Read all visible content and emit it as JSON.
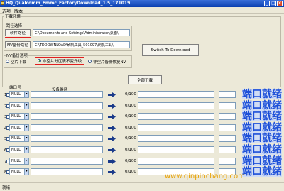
{
  "window": {
    "title": "HQ_Qualcomm_Emmc_FactoryDownload_1.5_171019"
  },
  "menu": {
    "items": [
      "选项",
      "版本"
    ]
  },
  "download_env": {
    "group_label": "下载环境",
    "path_group_label": "路径选择",
    "software_path_button": "软件路径",
    "software_path_value": "C:\\Documents and Settings\\Administrator\\桌面\\",
    "nv_backup_button": "NV备份路径",
    "nv_backup_value": "C:\\TDDOWNLOAD\\刷机工具_501097\\刷机工具\\"
  },
  "switch_button": "Switch To Download",
  "nv_options": {
    "group_label": "NV备份选项",
    "options": [
      "空片下载",
      "非空片分区表不变升级",
      "非空片备份恢复NV"
    ],
    "selected": 1
  },
  "download_all_button": "全部下载",
  "ports": {
    "port_header": "端口号",
    "device_path_header": "设备路径",
    "rows": [
      {
        "num": "1",
        "port": "NULL",
        "progress": "0/100",
        "status": "端口就绪"
      },
      {
        "num": "2",
        "port": "NULL",
        "progress": "0/100",
        "status": "端口就绪"
      },
      {
        "num": "3",
        "port": "NULL",
        "progress": "0/100",
        "status": "端口就绪"
      },
      {
        "num": "4",
        "port": "NULL",
        "progress": "0/100",
        "status": "端口就绪"
      },
      {
        "num": "5",
        "port": "NULL",
        "progress": "0/100",
        "status": "端口就绪"
      },
      {
        "num": "6",
        "port": "NULL",
        "progress": "0/100",
        "status": "端口就绪"
      },
      {
        "num": "7",
        "port": "NULL",
        "progress": "0/100",
        "status": "端口就绪"
      },
      {
        "num": "8",
        "port": "NULL",
        "progress": "0/100",
        "status": "端口就绪"
      }
    ]
  },
  "statusbar": {
    "text": "就绪"
  },
  "watermark": {
    "text": "www.qinpinchang.com"
  },
  "colors": {
    "status_text": "#1c4fd8",
    "status_bg": "#d0dcf4",
    "highlight": "#e02020"
  }
}
